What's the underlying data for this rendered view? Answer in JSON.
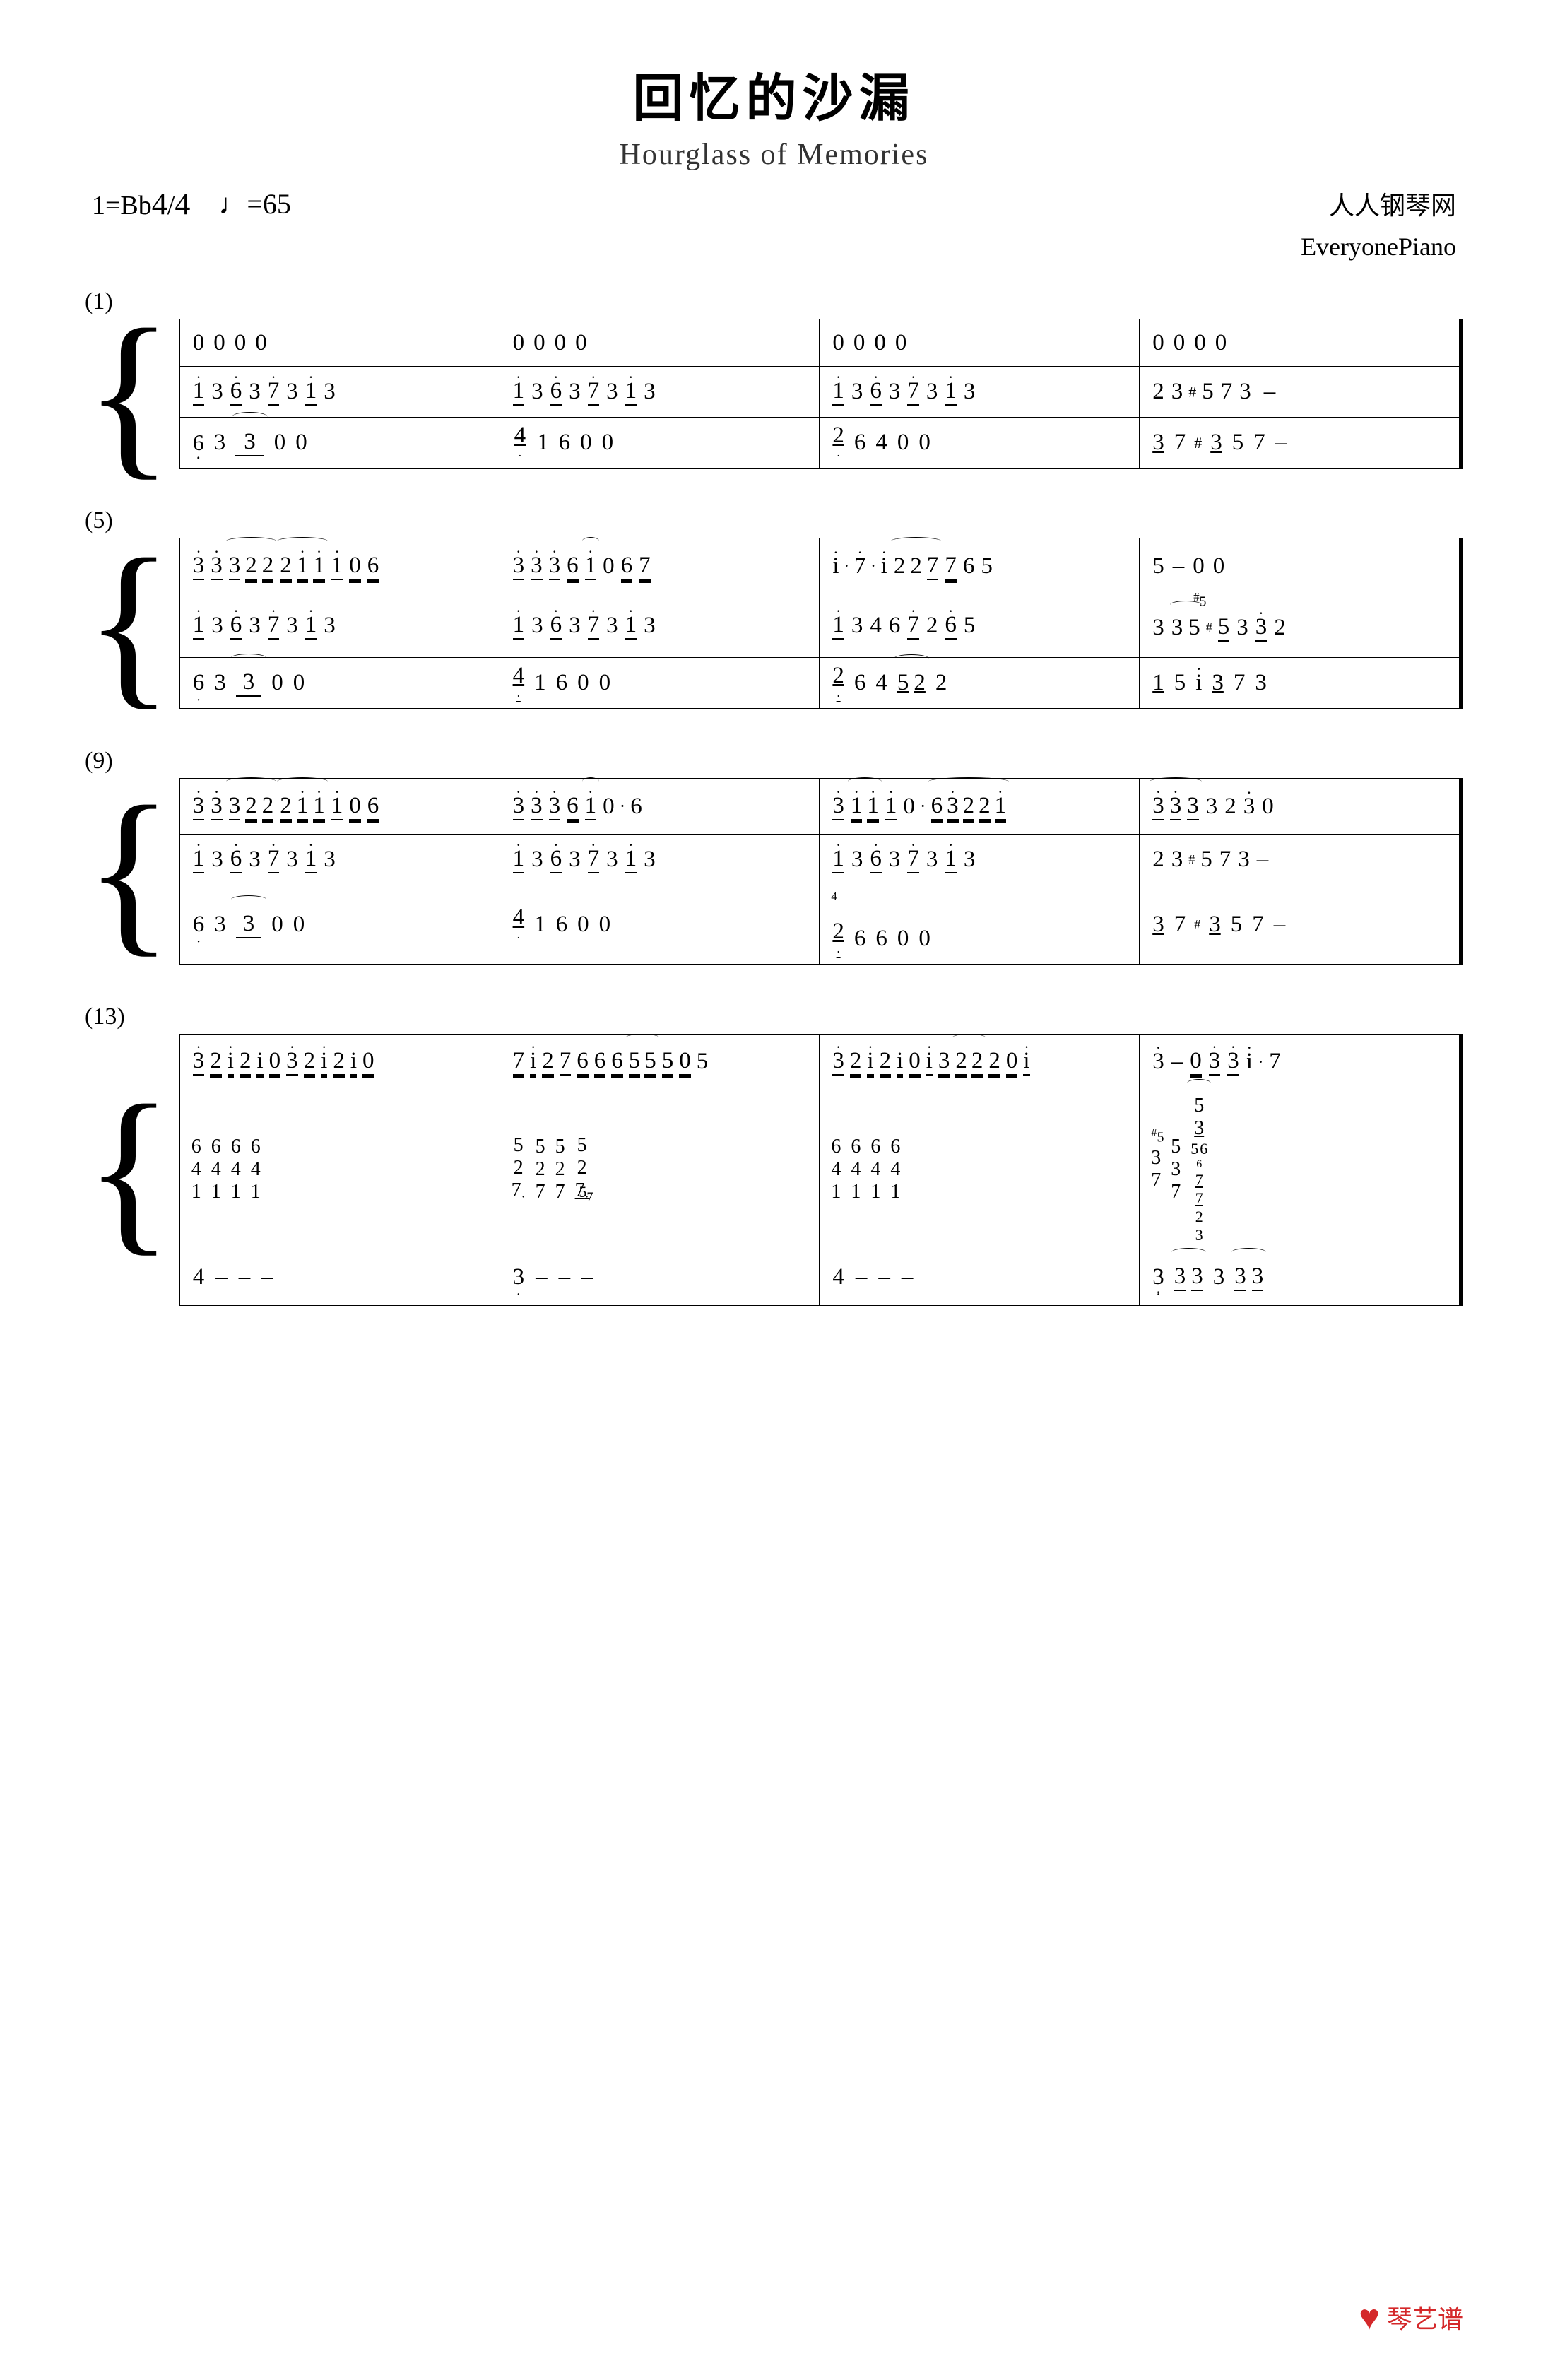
{
  "title": {
    "main": "回忆的沙漏",
    "subtitle": "Hourglass of Memories",
    "key": "1=Bb",
    "time_sig": "4/4",
    "tempo": "♩=65",
    "publisher_cn": "人人钢琴网",
    "publisher_en": "EveryonePiano"
  },
  "logo": {
    "text": "琴艺谱",
    "icon": "♥"
  },
  "sections": [
    {
      "num": "(1)"
    },
    {
      "num": "(5)"
    },
    {
      "num": "(9)"
    },
    {
      "num": "(13)"
    }
  ]
}
